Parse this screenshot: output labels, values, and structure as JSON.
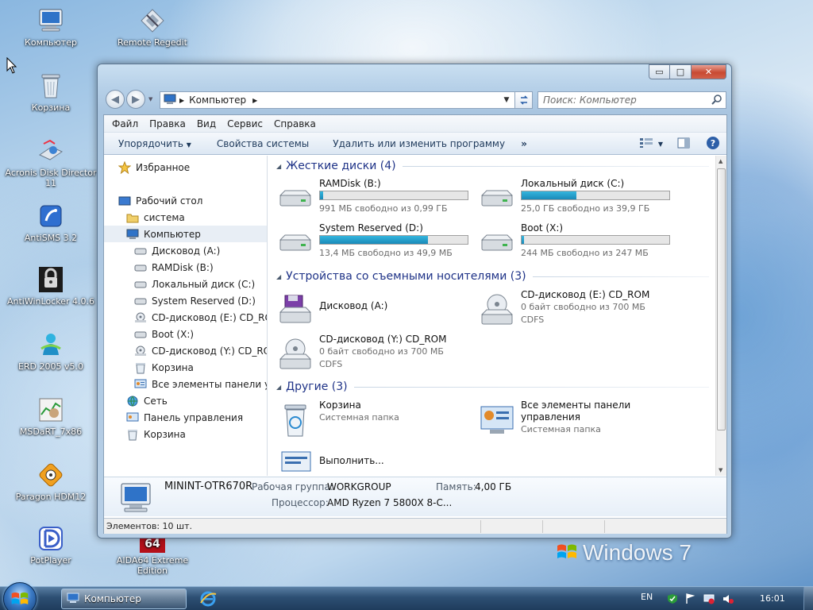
{
  "desktop": {
    "icons": [
      {
        "label": "Компьютер",
        "icon": "computer-icon"
      },
      {
        "label": "Remote Regedit",
        "icon": "regedit-icon"
      },
      {
        "label": "Корзина",
        "icon": "recycle-bin-icon"
      },
      {
        "label": "Acronis Disk Director 11",
        "icon": "acronis-icon"
      },
      {
        "label": "AntiSMS 3.2",
        "icon": "antisms-icon"
      },
      {
        "label": "AntiWinLocker 4.0.6",
        "icon": "lock-icon"
      },
      {
        "label": "ERD 2005 v5.0",
        "icon": "erd-icon"
      },
      {
        "label": "MSDaRT_7x86",
        "icon": "msdart-icon"
      },
      {
        "label": "Paragon HDM12",
        "icon": "paragon-icon"
      },
      {
        "label": "PotPlayer",
        "icon": "potplayer-icon"
      },
      {
        "label": "AIDA64 Extreme Edition",
        "icon": "aida64-icon"
      }
    ],
    "brand": "Windows 7",
    "aida_badge": "64"
  },
  "window": {
    "buttons": {
      "minimize": "▭",
      "maximize": "□",
      "close": "✕"
    },
    "address": {
      "path": "Компьютер"
    },
    "search": {
      "placeholder": "Поиск: Компьютер"
    },
    "menu": [
      "Файл",
      "Правка",
      "Вид",
      "Сервис",
      "Справка"
    ],
    "commands": {
      "organize": "Упорядочить",
      "system_properties": "Свойства системы",
      "uninstall": "Удалить или изменить программу",
      "more": "»"
    },
    "nav": {
      "favorites": "Избранное",
      "desktop": "Рабочий стол",
      "system": "система",
      "computer": "Компьютер",
      "drive_a": "Дисковод (A:)",
      "ramdisk": "RAMDisk (B:)",
      "drive_c": "Локальный диск (C:)",
      "drive_d": "System Reserved (D:)",
      "drive_e": "CD-дисковод (E:) CD_ROM",
      "drive_x": "Boot (X:)",
      "drive_y": "CD-дисковод (Y:) CD_ROM",
      "recycle": "Корзина",
      "all_cp": "Все элементы панели упр",
      "network": "Сеть",
      "control_panel": "Панель управления",
      "recycle2": "Корзина"
    },
    "groups": {
      "hdd": "Жесткие диски (4)",
      "removable": "Устройства со съемными носителями (3)",
      "other": "Другие (3)"
    },
    "drives": [
      {
        "name": "RAMDisk (B:)",
        "free": "991 МБ свободно из 0,99 ГБ",
        "used_fraction": 0.02
      },
      {
        "name": "Локальный диск (C:)",
        "free": "25,0 ГБ свободно из 39,9 ГБ",
        "used_fraction": 0.37
      },
      {
        "name": "System Reserved (D:)",
        "free": "13,4 МБ свободно из 49,9 МБ",
        "used_fraction": 0.73
      },
      {
        "name": "Boot (X:)",
        "free": "244 МБ свободно из 247 МБ",
        "used_fraction": 0.01
      }
    ],
    "removable": [
      {
        "name": "Дисковод (A:)"
      },
      {
        "name": "CD-дисковод (E:) CD_ROM",
        "free": "0 байт свободно из 700 МБ",
        "fs": "CDFS"
      },
      {
        "name": "CD-дисковод (Y:) CD_ROM",
        "free": "0 байт свободно из 700 МБ",
        "fs": "CDFS"
      }
    ],
    "other": [
      {
        "name": "Корзина",
        "sub": "Системная папка"
      },
      {
        "name": "Все элементы панели",
        "name2": "управления",
        "sub": "Системная папка"
      },
      {
        "name": "Выполнить..."
      }
    ],
    "details": {
      "computer_name": "MININT-OTR670R",
      "workgroup_label": "Рабочая группа:",
      "workgroup": "WORKGROUP",
      "memory_label": "Память:",
      "memory": "4,00 ГБ",
      "cpu_label": "Процессор:",
      "cpu": "AMD Ryzen 7 5800X 8-C..."
    },
    "status": "Элементов: 10 шт."
  },
  "taskbar": {
    "task": "Компьютер",
    "lang": "EN",
    "clock": "16:01"
  },
  "colors": {
    "accent": "#1e3287",
    "bar": "#26a0cc",
    "close": "#c84a32"
  }
}
